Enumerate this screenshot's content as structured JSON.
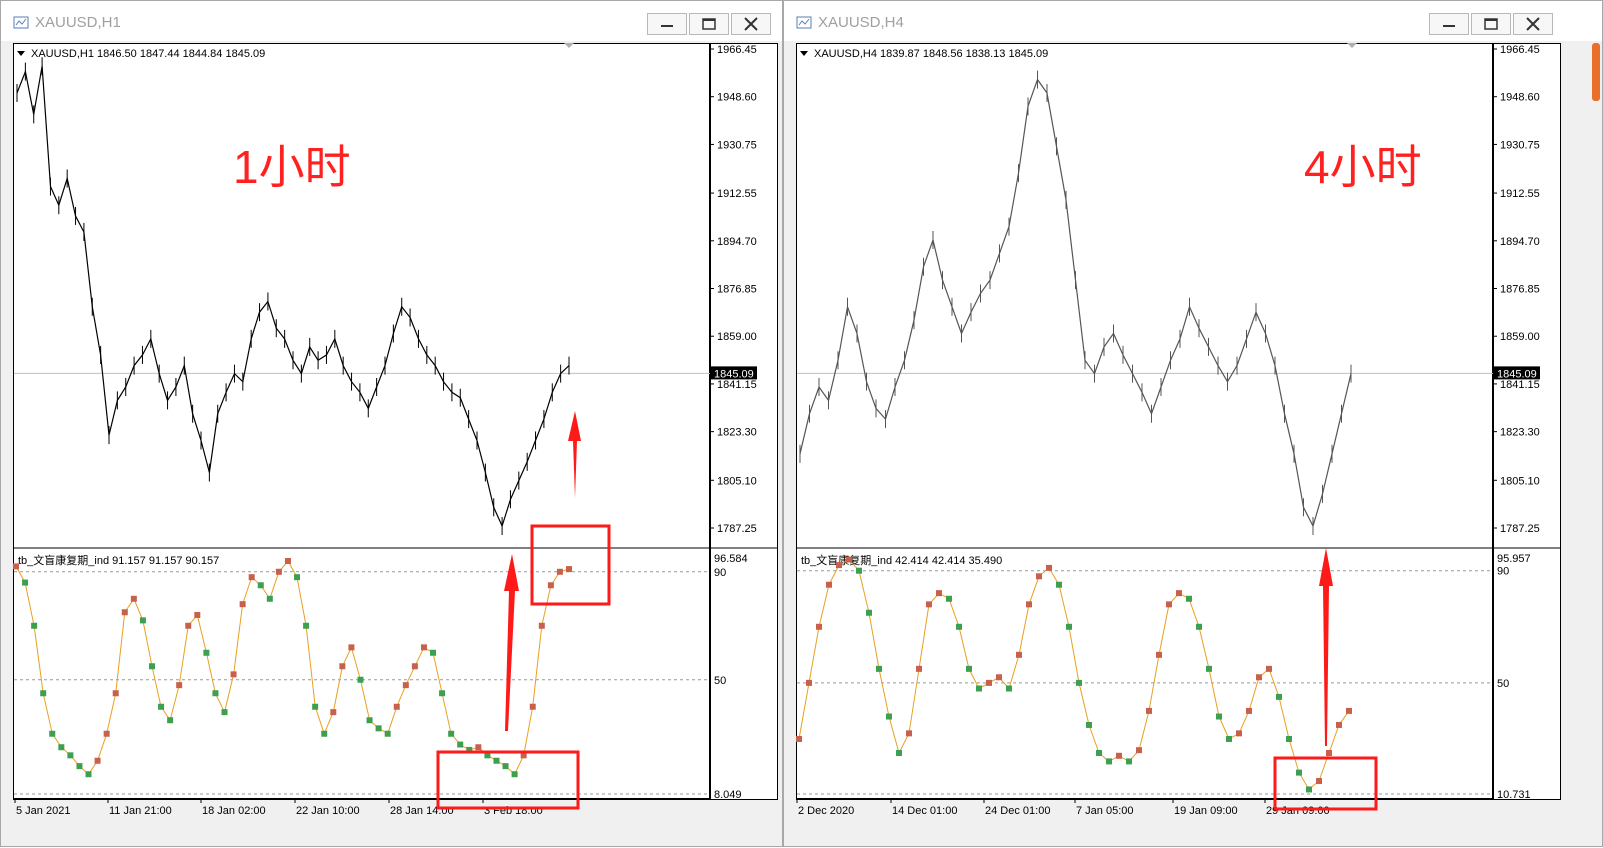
{
  "windows": [
    {
      "title": "XAUUSD,H1",
      "header": "XAUUSD,H1   1846.50 1847.44 1844.84 1845.09",
      "annotation": "1小时",
      "price_labels": [
        "1966.45",
        "1948.60",
        "1930.75",
        "1912.55",
        "1894.70",
        "1876.85",
        "1859.00",
        "1841.15",
        "1823.30",
        "1805.10",
        "1787.25"
      ],
      "current_price": "1845.09",
      "indicator_header": "tb_文盲康复期_ind 91.157 91.157 90.157",
      "indicator_labels": {
        "top": "96.584",
        "l90": "90",
        "l50": "50",
        "bottom": "8.049"
      },
      "time_labels": [
        "5 Jan 2021",
        "11 Jan 21:00",
        "18 Jan 02:00",
        "22 Jan 10:00",
        "28 Jan 14:00",
        "3 Feb 18:00"
      ]
    },
    {
      "title": "XAUUSD,H4",
      "header": "XAUUSD,H4   1839.87 1848.56 1838.13 1845.09",
      "annotation": "4小时",
      "price_labels": [
        "1966.45",
        "1948.60",
        "1930.75",
        "1912.55",
        "1894.70",
        "1876.85",
        "1859.00",
        "1841.15",
        "1823.30",
        "1805.10",
        "1787.25"
      ],
      "current_price": "1845.09",
      "indicator_header": "tb_文盲康复期_ind 42.414 42.414 35.490",
      "indicator_labels": {
        "top": "95.957",
        "l90": "90",
        "l50": "50",
        "bottom": "10.731"
      },
      "time_labels": [
        "2 Dec 2020",
        "14 Dec 01:00",
        "24 Dec 01:00",
        "7 Jan 05:00",
        "19 Jan 09:00",
        "29 Jan 09:00"
      ]
    }
  ],
  "chart_data": [
    {
      "type": "line",
      "title": "XAUUSD,H1",
      "ylim": [
        1787.25,
        1966.45
      ],
      "series": [
        {
          "name": "XAUUSD,H1",
          "values": [
            1950,
            1958,
            1942,
            1960,
            1915,
            1908,
            1918,
            1904,
            1898,
            1870,
            1852,
            1822,
            1835,
            1840,
            1848,
            1852,
            1858,
            1845,
            1835,
            1840,
            1848,
            1830,
            1820,
            1808,
            1830,
            1838,
            1845,
            1842,
            1858,
            1868,
            1872,
            1862,
            1858,
            1850,
            1845,
            1855,
            1850,
            1852,
            1858,
            1848,
            1842,
            1838,
            1832,
            1840,
            1848,
            1860,
            1870,
            1866,
            1858,
            1852,
            1848,
            1842,
            1838,
            1836,
            1828,
            1820,
            1808,
            1795,
            1788,
            1798,
            1805,
            1812,
            1820,
            1828,
            1838,
            1845,
            1848
          ]
        }
      ]
    },
    {
      "type": "line",
      "title": "tb_文盲康复期_ind (H1)",
      "ylim": [
        8.049,
        96.584
      ],
      "series": [
        {
          "name": "tb_文盲康复期_ind",
          "values": [
            92,
            86,
            70,
            45,
            30,
            25,
            22,
            18,
            15,
            20,
            30,
            45,
            75,
            80,
            72,
            55,
            40,
            35,
            48,
            70,
            74,
            60,
            45,
            38,
            52,
            78,
            88,
            85,
            80,
            90,
            94,
            88,
            70,
            40,
            30,
            38,
            55,
            62,
            50,
            35,
            32,
            30,
            40,
            48,
            55,
            62,
            60,
            45,
            30,
            26,
            24,
            25,
            22,
            20,
            18,
            15,
            22,
            40,
            70,
            85,
            90,
            91
          ]
        }
      ]
    },
    {
      "type": "line",
      "title": "XAUUSD,H4",
      "ylim": [
        1787.25,
        1966.45
      ],
      "series": [
        {
          "name": "XAUUSD,H4",
          "values": [
            1815,
            1830,
            1840,
            1835,
            1850,
            1870,
            1860,
            1842,
            1832,
            1828,
            1840,
            1850,
            1865,
            1885,
            1895,
            1880,
            1870,
            1860,
            1868,
            1875,
            1880,
            1890,
            1900,
            1920,
            1945,
            1955,
            1950,
            1930,
            1910,
            1880,
            1850,
            1845,
            1855,
            1860,
            1852,
            1845,
            1838,
            1830,
            1840,
            1850,
            1858,
            1870,
            1862,
            1855,
            1848,
            1842,
            1848,
            1858,
            1868,
            1860,
            1848,
            1830,
            1815,
            1795,
            1788,
            1800,
            1815,
            1830,
            1845
          ]
        }
      ]
    },
    {
      "type": "line",
      "title": "tb_文盲康复期_ind (H4)",
      "ylim": [
        10.731,
        95.957
      ],
      "series": [
        {
          "name": "tb_文盲康复期_ind",
          "values": [
            30,
            50,
            70,
            85,
            92,
            94,
            90,
            75,
            55,
            38,
            25,
            32,
            55,
            78,
            82,
            80,
            70,
            55,
            48,
            50,
            52,
            48,
            60,
            78,
            88,
            91,
            85,
            70,
            50,
            35,
            25,
            22,
            24,
            22,
            26,
            40,
            60,
            78,
            82,
            80,
            70,
            55,
            38,
            30,
            32,
            40,
            52,
            55,
            45,
            30,
            18,
            12,
            15,
            25,
            35,
            40
          ]
        }
      ]
    }
  ]
}
